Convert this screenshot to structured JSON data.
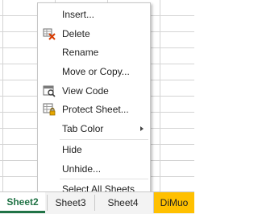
{
  "context_menu": {
    "items": [
      {
        "label": "Insert...",
        "icon": ""
      },
      {
        "label": "Delete",
        "icon": "delete-sheet-icon"
      },
      {
        "label": "Rename",
        "icon": ""
      },
      {
        "label": "Move or Copy...",
        "icon": ""
      },
      {
        "label": "View Code",
        "icon": "view-code-icon"
      },
      {
        "label": "Protect Sheet...",
        "icon": "protect-sheet-icon"
      },
      {
        "label": "Tab Color",
        "icon": "",
        "submenu": true
      },
      {
        "label": "Hide",
        "icon": ""
      },
      {
        "label": "Unhide...",
        "icon": ""
      },
      {
        "label": "Select All Sheets",
        "icon": ""
      }
    ]
  },
  "tabs": [
    {
      "label": "Sheet2",
      "active": true
    },
    {
      "label": "Sheet3"
    },
    {
      "label": "Sheet4"
    },
    {
      "label": "DiMuo",
      "color": "#ffc000"
    }
  ],
  "colors": {
    "active_tab_accent": "#217346",
    "dimuo_tab": "#ffc000",
    "delete_icon_red": "#d83b01"
  }
}
